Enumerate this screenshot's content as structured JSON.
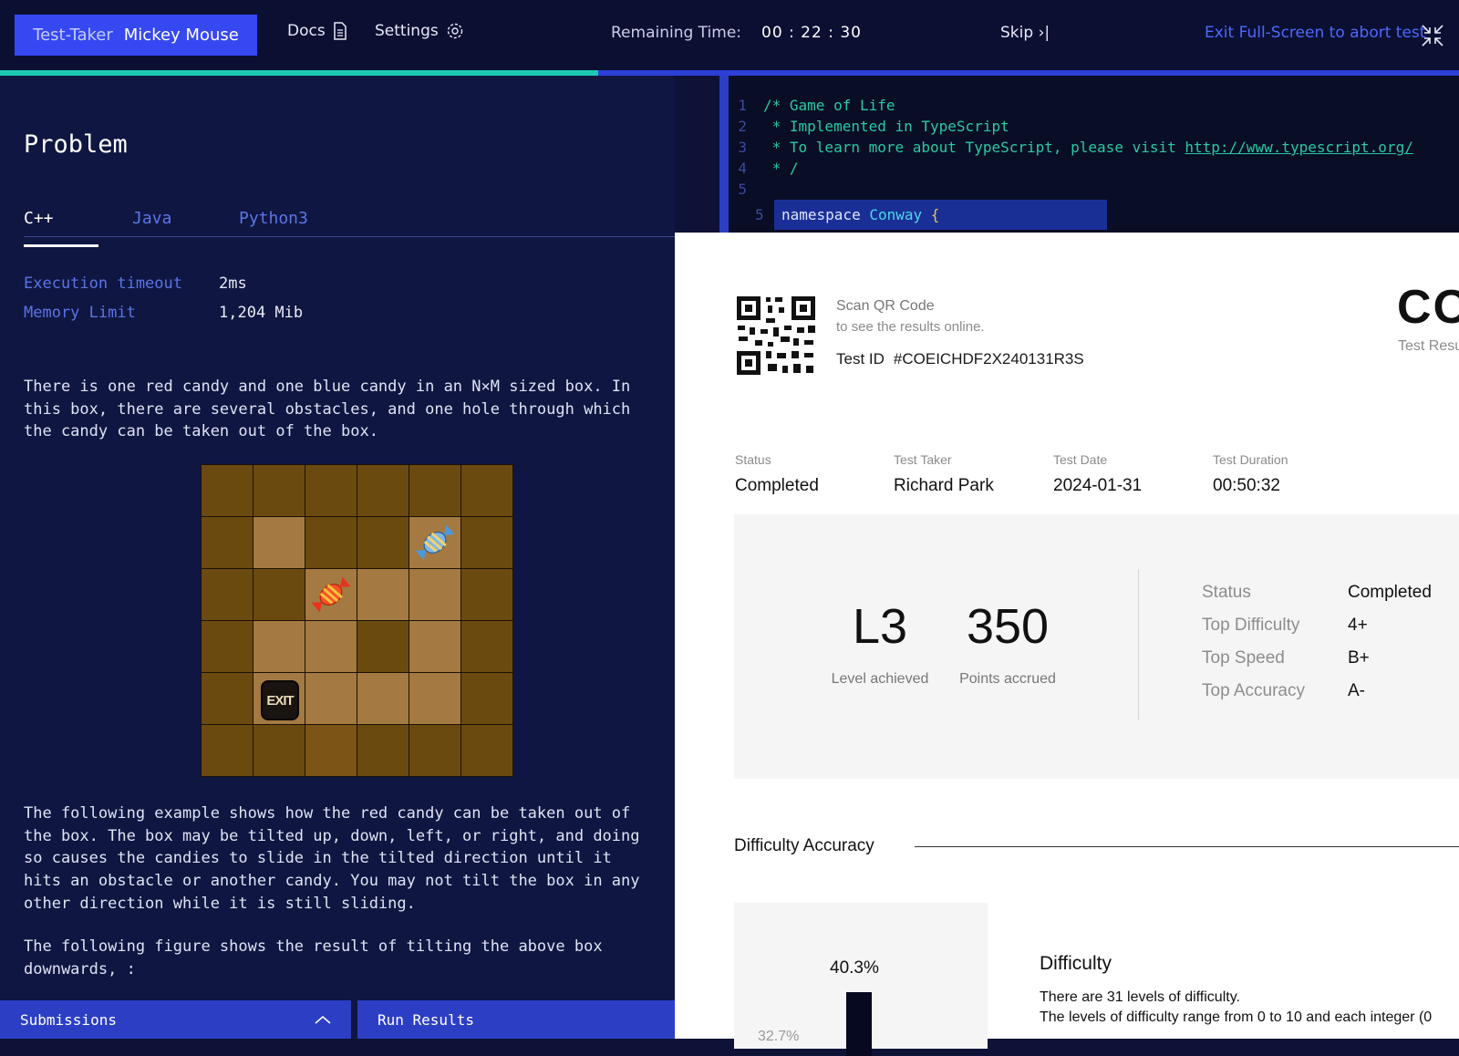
{
  "topbar": {
    "taker_label": "Test-Taker",
    "taker_name": "Mickey Mouse",
    "docs_label": "Docs",
    "settings_label": "Settings",
    "remaining_label": "Remaining Time:",
    "remaining_time": "00 : 22 : 30",
    "skip_label": "Skip",
    "exit_label": "Exit Full-Screen to abort test"
  },
  "progress": {
    "fraction": 0.41
  },
  "problem": {
    "title": "Problem",
    "tabs": [
      "C++",
      "Java",
      "Python3"
    ],
    "active_tab": "C++",
    "meta": [
      {
        "key": "Execution timeout",
        "value": "2ms"
      },
      {
        "key": "Memory Limit",
        "value": "1,204 Mib"
      }
    ],
    "para1": "There is one red candy and one blue candy in an N×M sized box. In\nthis box, there are several obstacles, and one hole through which\nthe candy can be taken out of the box.",
    "para2": "The following example shows how the red candy can be taken out of\nthe box. The box may be tilted up, down, left, or right, and doing\nso causes the candies to slide in the tilted direction until it\nhits an obstacle or another candy. You may not tilt the box in any\nother direction while it is still sliding.",
    "para3": "The following figure shows the result of tilting the above box\ndownwards, :",
    "exit_sign": "EXIT"
  },
  "bottom_tabs": {
    "submissions": "Submissions",
    "run_results": "Run Results"
  },
  "editor": {
    "lines": [
      {
        "n": "1",
        "text": "/* Game of Life"
      },
      {
        "n": "2",
        "text": " * Implemented in TypeScript"
      },
      {
        "n": "3",
        "text": " * To learn more about TypeScript, please visit "
      },
      {
        "n": "4",
        "text": " * /"
      },
      {
        "n": "5",
        "text": ""
      }
    ],
    "url": "http://www.typescript.org/",
    "hl_number": "5",
    "hl_keyword": "namespace",
    "hl_name": "Conway",
    "hl_brace": "{"
  },
  "results": {
    "scan_title": "Scan QR Code",
    "scan_sub": "to see the results online.",
    "test_id_label": "Test ID",
    "test_id": "#COEICHDF2X240131R3S",
    "big_letters": "CO",
    "test_res": "Test Resu",
    "info": [
      {
        "key": "Status",
        "value": "Completed"
      },
      {
        "key": "Test Taker",
        "value": "Richard Park"
      },
      {
        "key": "Test Date",
        "value": "2024-01-31"
      },
      {
        "key": "Test Duration",
        "value": "00:50:32"
      }
    ],
    "level": "L3",
    "level_label": "Level achieved",
    "points": "350",
    "points_label": "Points accrued",
    "stats": [
      {
        "key": "Status",
        "value": "Completed"
      },
      {
        "key": "Top Difficulty",
        "value": "4+"
      },
      {
        "key": "Top Speed",
        "value": "B+"
      },
      {
        "key": "Top Accuracy",
        "value": "A-"
      }
    ],
    "da_title": "Difficulty Accuracy",
    "bar_value": "40.3%",
    "side_value": "32.7%",
    "difficulty_title": "Difficulty",
    "difficulty_text1": "There are 31 levels of difficulty.",
    "difficulty_text2": "The levels of difficulty range from 0 to 10 and each integer (0"
  },
  "colors": {
    "accent": "#3548f2",
    "progress": "#1ec9b4",
    "panel": "#0f1641"
  }
}
